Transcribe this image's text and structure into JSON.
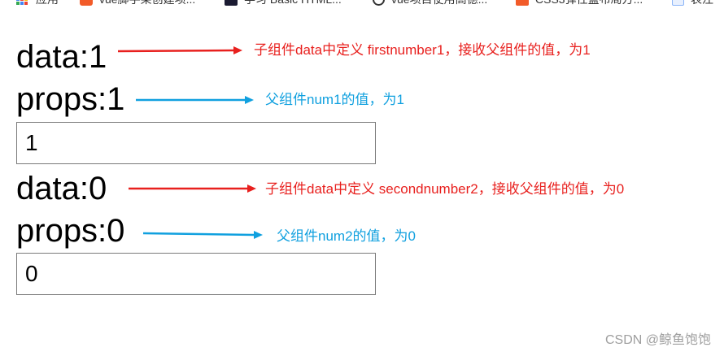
{
  "bookmarks": [
    {
      "label": "应用",
      "icon": "apps-grid-icon",
      "color": "#4285f4"
    },
    {
      "label": "vue脚手架创建项...",
      "icon": "csdn-c-icon",
      "color": "#f25b29"
    },
    {
      "label": "学习 Basic HTML...",
      "icon": "freecodecamp-icon",
      "color": "#1b1b32"
    },
    {
      "label": "vue项目使用高德...",
      "icon": "search-like-icon",
      "color": "#333333"
    },
    {
      "label": "CSS3弹性盒布局方...",
      "icon": "orange-square-icon",
      "color": "#f25b29"
    },
    {
      "label": "表注",
      "icon": "page-icon",
      "color": "#8ab4f8"
    }
  ],
  "rows": {
    "data1": "data:1",
    "props1": "props:1",
    "input1": "1",
    "data2": "data:0",
    "props2": "props:0",
    "input2": "0"
  },
  "annotations": {
    "data1": "子组件data中定义 firstnumber1，接收父组件的值，为1",
    "props1": "父组件num1的值，为1",
    "data2": "子组件data中定义 secondnumber2，接收父组件的值，为0",
    "props2": "父组件num2的值，为0"
  },
  "colors": {
    "red": "#e8201e",
    "blue": "#10a0df"
  },
  "watermark": "CSDN @鲸鱼饱饱"
}
